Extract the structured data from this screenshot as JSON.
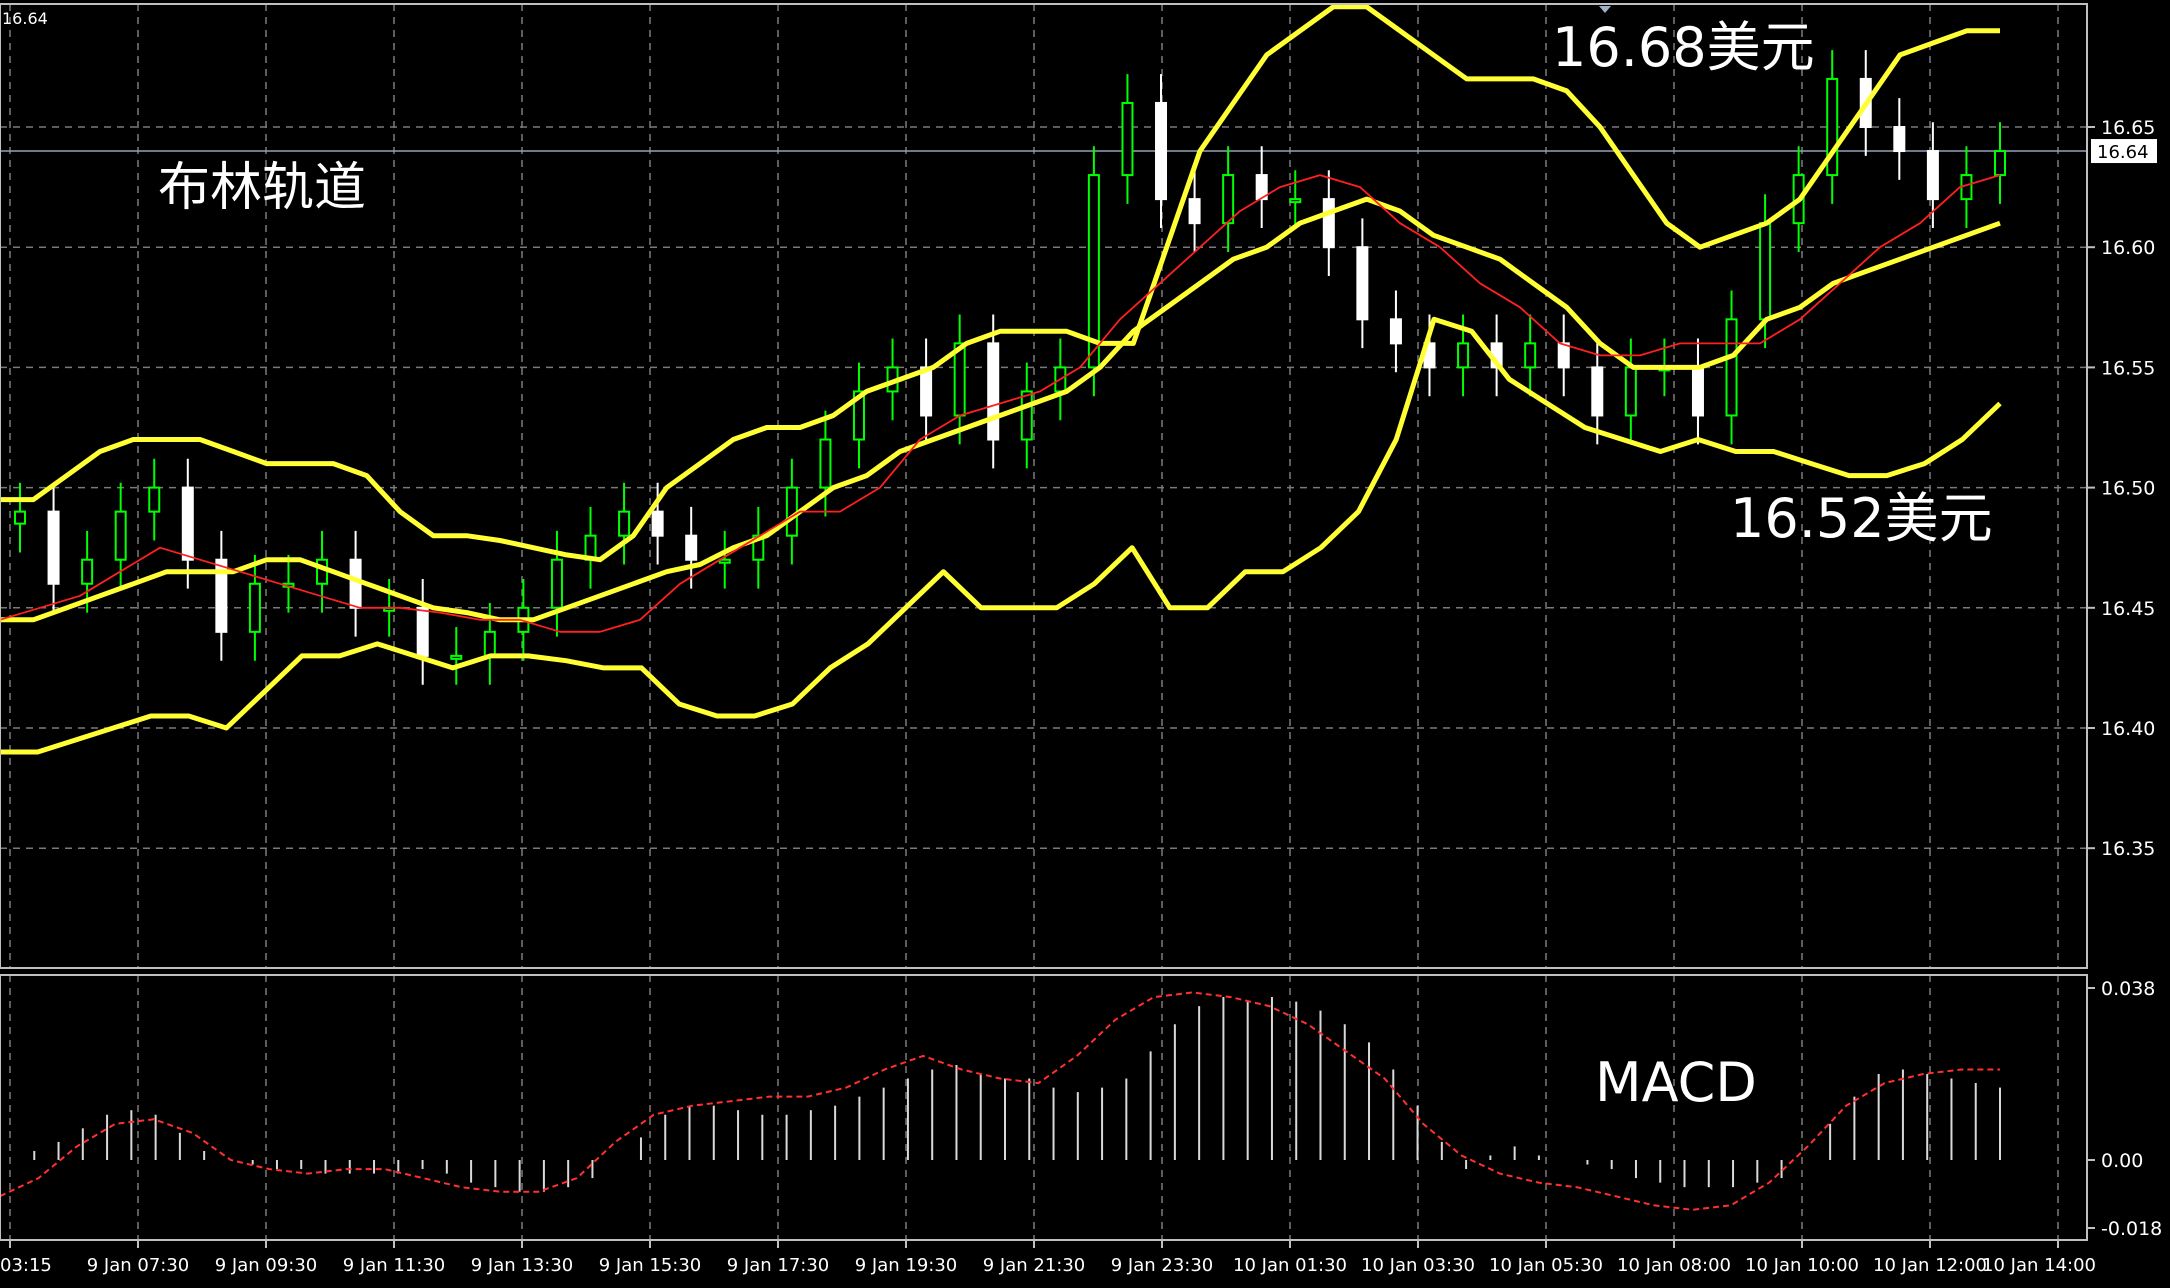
{
  "chart_data": [
    {
      "type": "line",
      "panel": "price",
      "x_ticks": [
        "03:15",
        "9 Jan 07:30",
        "9 Jan 09:30",
        "9 Jan 11:30",
        "9 Jan 13:30",
        "9 Jan 15:30",
        "9 Jan 17:30",
        "9 Jan 19:30",
        "9 Jan 21:30",
        "9 Jan 23:30",
        "10 Jan 01:30",
        "10 Jan 03:30",
        "10 Jan 05:30",
        "10 Jan 08:00",
        "10 Jan 10:00",
        "10 Jan 12:00",
        "10 Jan 14:00"
      ],
      "y_ticks": [
        16.35,
        16.4,
        16.45,
        16.5,
        16.55,
        16.6,
        16.65
      ],
      "ylim": [
        16.3,
        16.7
      ],
      "current_price": 16.64,
      "current_price_label": "16.64",
      "corner_label": "16.64",
      "grid": true,
      "annotations": [
        "布林轨道",
        "16.68美元",
        "16.52美元"
      ],
      "series": [
        {
          "role": "bollinger-upper",
          "color": "#ffff33",
          "values": [
            16.495,
            16.495,
            16.505,
            16.515,
            16.52,
            16.52,
            16.52,
            16.515,
            16.51,
            16.51,
            16.51,
            16.505,
            16.49,
            16.48,
            16.48,
            16.478,
            16.475,
            16.472,
            16.47,
            16.48,
            16.5,
            16.51,
            16.52,
            16.525,
            16.525,
            16.53,
            16.54,
            16.545,
            16.55,
            16.56,
            16.565,
            16.565,
            16.565,
            16.56,
            16.56,
            16.6,
            16.64,
            16.66,
            16.68,
            16.69,
            16.7,
            16.7,
            16.69,
            16.68,
            16.67,
            16.67,
            16.67,
            16.665,
            16.65,
            16.63,
            16.61,
            16.6,
            16.605,
            16.61,
            16.62,
            16.64,
            16.66,
            16.68,
            16.685,
            16.69,
            16.69
          ]
        },
        {
          "role": "bollinger-middle",
          "color": "#ffff33",
          "values": [
            16.445,
            16.445,
            16.45,
            16.455,
            16.46,
            16.465,
            16.465,
            16.465,
            16.47,
            16.47,
            16.465,
            16.46,
            16.455,
            16.45,
            16.448,
            16.445,
            16.445,
            16.45,
            16.455,
            16.46,
            16.465,
            16.468,
            16.475,
            16.48,
            16.49,
            16.5,
            16.505,
            16.515,
            16.52,
            16.525,
            16.53,
            16.535,
            16.54,
            16.55,
            16.565,
            16.575,
            16.585,
            16.595,
            16.6,
            16.61,
            16.615,
            16.62,
            16.615,
            16.605,
            16.6,
            16.595,
            16.585,
            16.575,
            16.56,
            16.55,
            16.55,
            16.55,
            16.555,
            16.57,
            16.575,
            16.585,
            16.59,
            16.595,
            16.6,
            16.605,
            16.61
          ]
        },
        {
          "role": "bollinger-lower",
          "color": "#ffff33",
          "values": [
            16.39,
            16.39,
            16.395,
            16.4,
            16.405,
            16.405,
            16.4,
            16.415,
            16.43,
            16.43,
            16.435,
            16.43,
            16.425,
            16.43,
            16.43,
            16.428,
            16.425,
            16.425,
            16.41,
            16.405,
            16.405,
            16.41,
            16.425,
            16.435,
            16.45,
            16.465,
            16.45,
            16.45,
            16.45,
            16.46,
            16.475,
            16.45,
            16.45,
            16.465,
            16.465,
            16.475,
            16.49,
            16.52,
            16.57,
            16.565,
            16.545,
            16.535,
            16.525,
            16.52,
            16.515,
            16.52,
            16.515,
            16.515,
            16.51,
            16.505,
            16.505,
            16.51,
            16.52,
            16.535
          ]
        },
        {
          "role": "moving-average",
          "color": "#ff2020",
          "values": [
            16.445,
            16.45,
            16.455,
            16.465,
            16.475,
            16.47,
            16.465,
            16.46,
            16.455,
            16.45,
            16.45,
            16.448,
            16.445,
            16.445,
            16.44,
            16.44,
            16.445,
            16.46,
            16.47,
            16.48,
            16.49,
            16.49,
            16.5,
            16.52,
            16.53,
            16.535,
            16.54,
            16.55,
            16.57,
            16.585,
            16.6,
            16.615,
            16.625,
            16.63,
            16.625,
            16.61,
            16.6,
            16.585,
            16.575,
            16.56,
            16.555,
            16.555,
            16.56,
            16.56,
            16.56,
            16.57,
            16.585,
            16.6,
            16.61,
            16.625,
            16.63
          ]
        },
        {
          "role": "candles",
          "up_color": "#00ff00",
          "down_color": "#ffffff",
          "values": [
            16.49,
            16.46,
            16.47,
            16.49,
            16.5,
            16.47,
            16.44,
            16.46,
            16.46,
            16.47,
            16.45,
            16.45,
            16.43,
            16.43,
            16.44,
            16.45,
            16.47,
            16.48,
            16.49,
            16.48,
            16.47,
            16.47,
            16.48,
            16.5,
            16.52,
            16.54,
            16.55,
            16.53,
            16.56,
            16.52,
            16.54,
            16.55,
            16.63,
            16.66,
            16.62,
            16.61,
            16.63,
            16.62,
            16.62,
            16.6,
            16.57,
            16.56,
            16.55,
            16.56,
            16.55,
            16.56,
            16.55,
            16.53,
            16.55,
            16.55,
            16.53,
            16.57,
            16.61,
            16.63,
            16.67,
            16.65,
            16.64,
            16.62,
            16.63,
            16.64
          ]
        }
      ]
    },
    {
      "type": "bar",
      "panel": "macd",
      "y_ticks": [
        0.038,
        0.0,
        -0.018
      ],
      "ylim": [
        -0.018,
        0.038
      ],
      "annotations": [
        "MACD"
      ],
      "series": [
        {
          "role": "histogram",
          "color": "#d9d9d9",
          "values": [
            0.0,
            0.002,
            0.004,
            0.007,
            0.01,
            0.011,
            0.01,
            0.006,
            0.002,
            0.0,
            -0.001,
            -0.002,
            -0.002,
            -0.003,
            -0.003,
            -0.003,
            -0.003,
            -0.002,
            -0.003,
            -0.005,
            -0.006,
            -0.007,
            -0.007,
            -0.006,
            -0.004,
            0.0,
            0.005,
            0.01,
            0.012,
            0.012,
            0.011,
            0.01,
            0.01,
            0.011,
            0.012,
            0.014,
            0.016,
            0.018,
            0.02,
            0.021,
            0.019,
            0.018,
            0.018,
            0.016,
            0.015,
            0.016,
            0.018,
            0.024,
            0.03,
            0.034,
            0.036,
            0.035,
            0.036,
            0.035,
            0.033,
            0.03,
            0.026,
            0.02,
            0.012,
            0.004,
            -0.002,
            0.001,
            0.003,
            0.001,
            0.0,
            -0.001,
            -0.002,
            -0.004,
            -0.005,
            -0.006,
            -0.006,
            -0.006,
            -0.005,
            -0.004,
            0.0,
            0.008,
            0.014,
            0.019,
            0.02,
            0.019,
            0.018,
            0.017,
            0.016
          ]
        },
        {
          "role": "signal",
          "color": "#ff3030",
          "values": [
            -0.008,
            -0.004,
            0.003,
            0.008,
            0.009,
            0.006,
            0.0,
            -0.002,
            -0.003,
            -0.002,
            -0.002,
            -0.004,
            -0.006,
            -0.007,
            -0.007,
            -0.004,
            0.004,
            0.01,
            0.012,
            0.013,
            0.014,
            0.014,
            0.016,
            0.02,
            0.023,
            0.02,
            0.018,
            0.017,
            0.023,
            0.031,
            0.036,
            0.037,
            0.036,
            0.034,
            0.03,
            0.024,
            0.018,
            0.008,
            0.001,
            -0.003,
            -0.005,
            -0.006,
            -0.008,
            -0.01,
            -0.011,
            -0.01,
            -0.005,
            0.003,
            0.012,
            0.017,
            0.019,
            0.02,
            0.02
          ]
        }
      ]
    }
  ]
}
